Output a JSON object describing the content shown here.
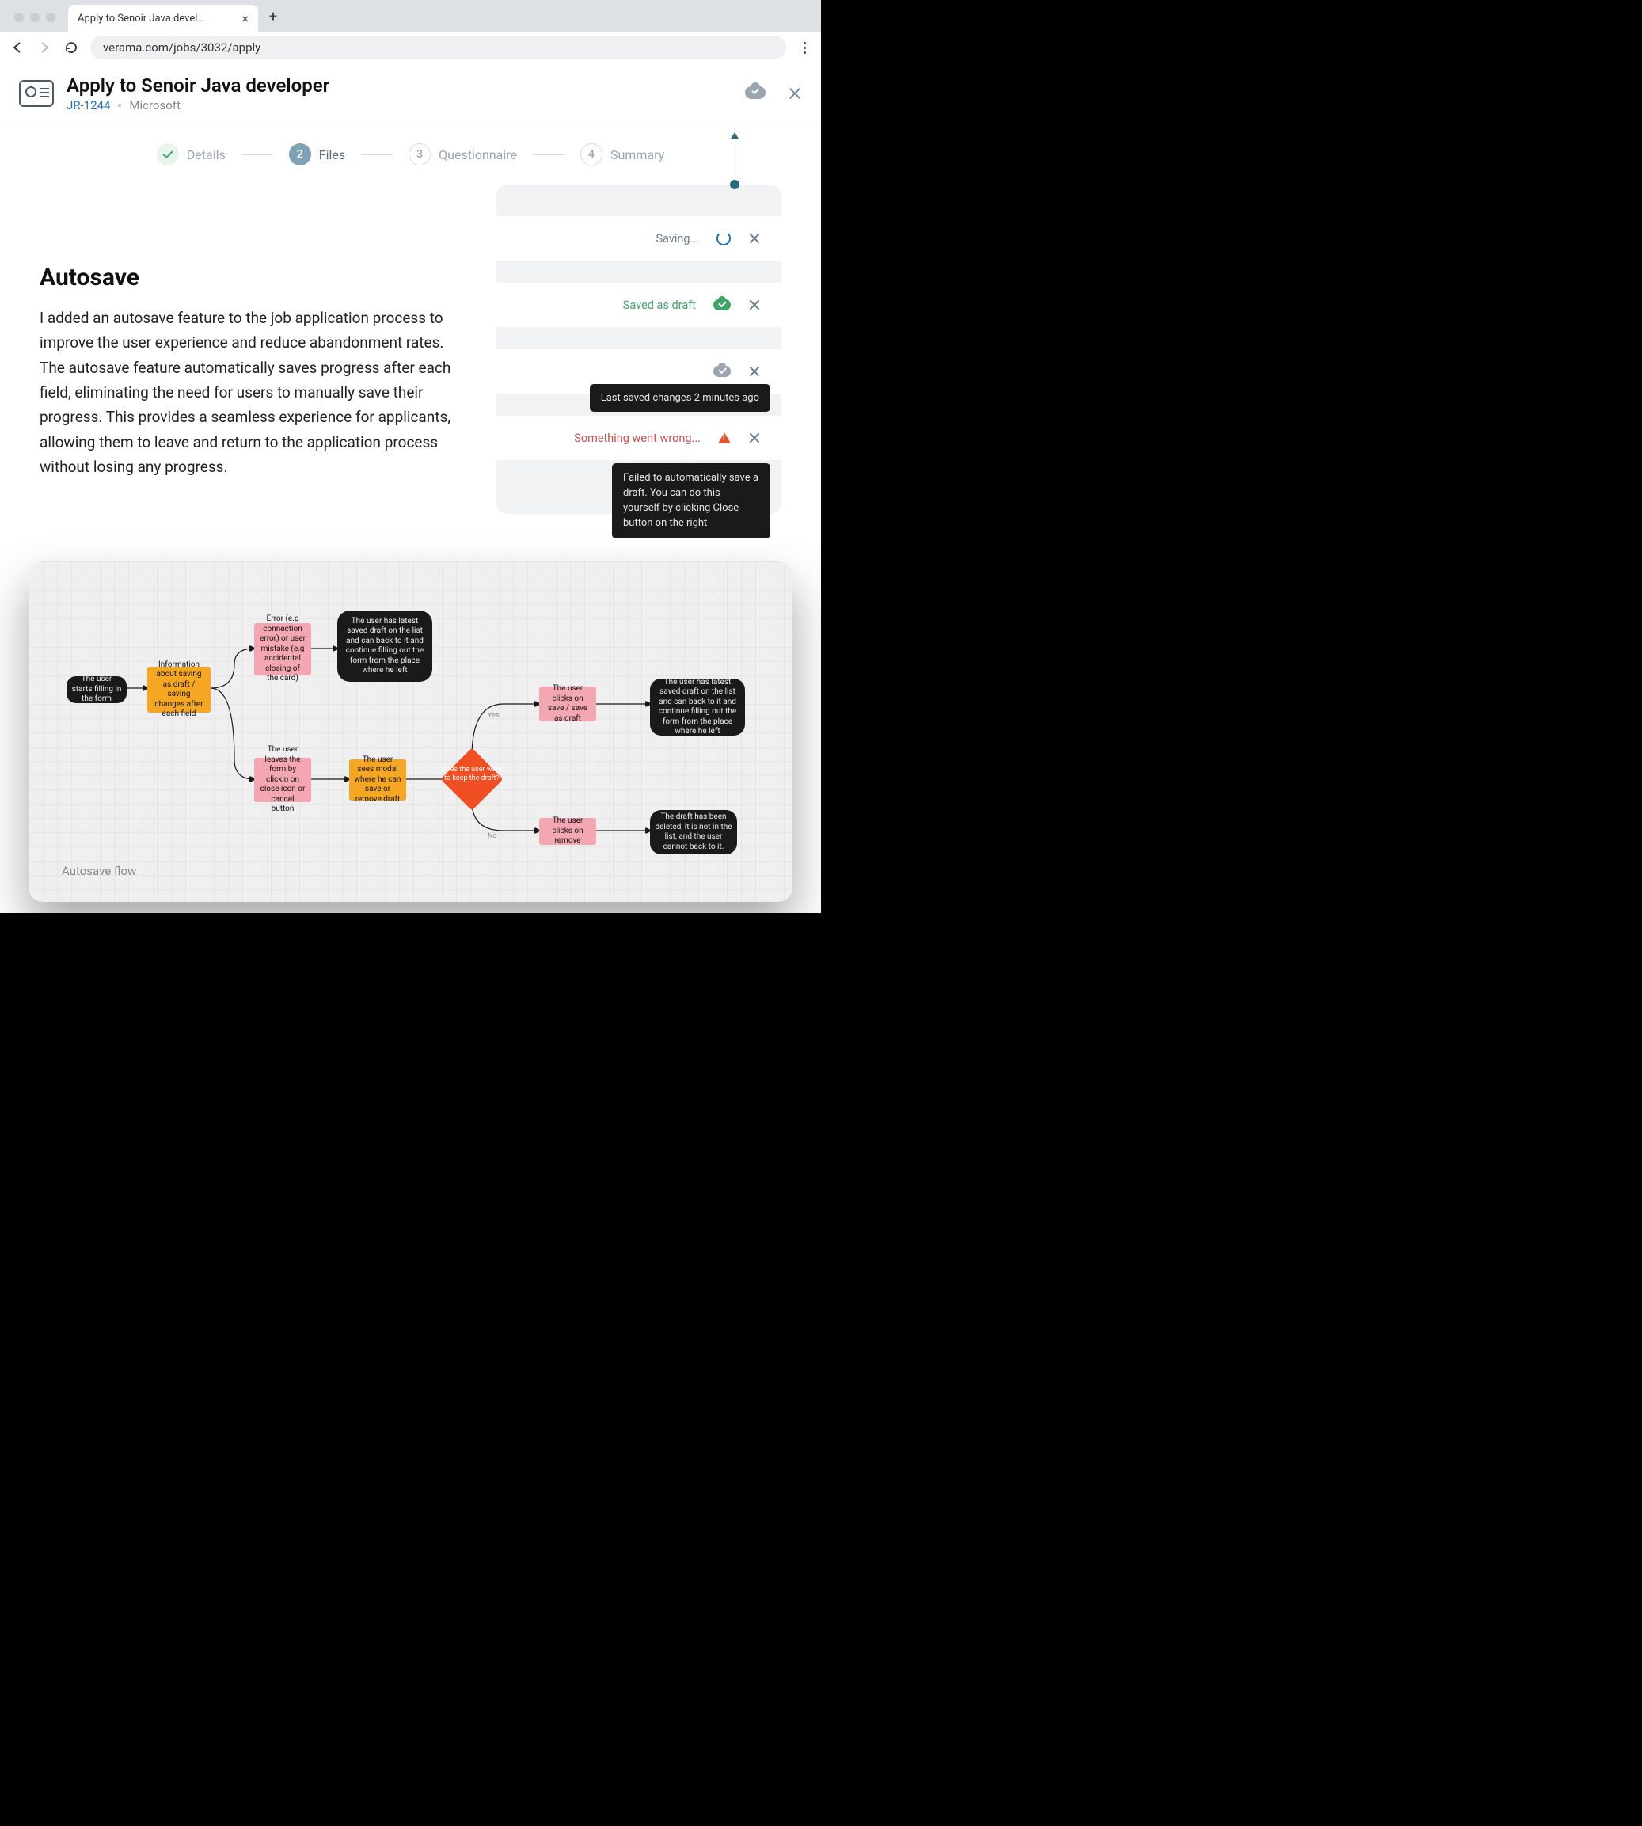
{
  "browser": {
    "tab_title": "Apply to Senoir Java developer",
    "url": "verama.com/jobs/3032/apply"
  },
  "header": {
    "title": "Apply to Senoir Java developer",
    "job_id": "JR-1244",
    "company": "Microsoft"
  },
  "stepper": {
    "s1": "Details",
    "s2_num": "2",
    "s2": "Files",
    "s3_num": "3",
    "s3": "Questionnaire",
    "s4_num": "4",
    "s4": "Summary"
  },
  "section": {
    "title": "Autosave",
    "body": "I added an autosave feature to the job application process to improve the user experience and reduce abandonment rates. The autosave feature automatically saves progress after each field, eliminating the need for users to manually save their progress. This provides a seamless experience for applicants, allowing them to leave and return to the application process without losing any progress."
  },
  "statuses": {
    "saving": "Saving...",
    "saved": "Saved as draft",
    "tooltip_saved": "Last saved changes 2 minutes ago",
    "error": "Something went wrong...",
    "tooltip_error": "Failed to automatically save a draft. You can do this yourself by clicking Close button on the right"
  },
  "flow": {
    "caption": "Autosave flow",
    "n1": "The user starts filling in the form",
    "n2": "Information about saving as draft / saving changes after each field",
    "n3": "Error (e.g connection error) or user mistake (e.g accidental closing of the card)",
    "n4": "The user has latest saved draft on the list and can back to it and continue filling out the form from the place where he left",
    "n5": "The user leaves the form by clickin on close icon or cancel button",
    "n6": "The user sees modal where he can save or remove draft",
    "n7": "Does the user want to keep the draft?",
    "n8": "The user clicks on save / save as draft",
    "n9": "The user has latest saved draft on the list and can back to it and continue filling out the form from the place where he left",
    "n10": "The user clicks on remove",
    "n11": "The draft has been deleted, it is not in the list, and the user cannot back to it.",
    "yes": "Yes",
    "no": "No"
  }
}
